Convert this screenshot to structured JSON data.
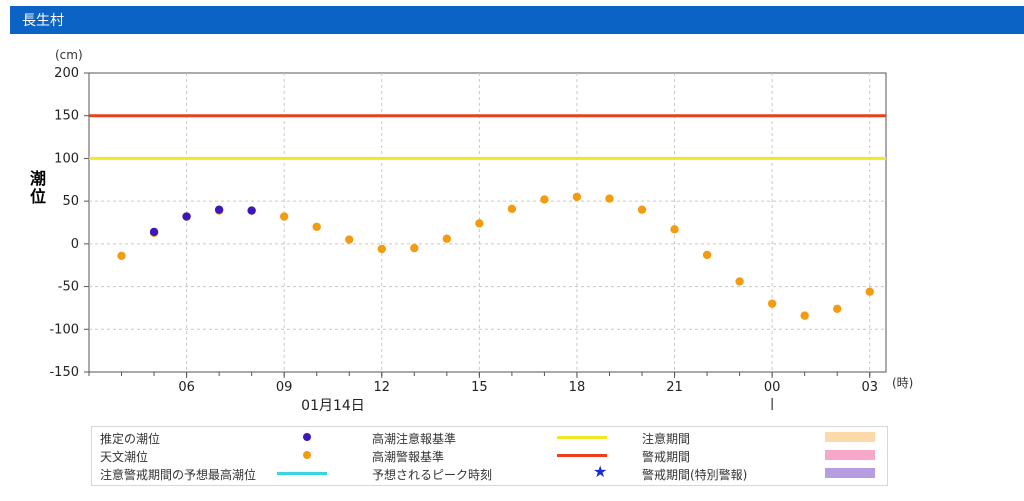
{
  "header": {
    "title": "長生村"
  },
  "chart_data": {
    "type": "scatter",
    "ylabel": "潮位",
    "yunit": "(cm)",
    "xunit": "(時)",
    "date_label": "01月14日",
    "ylim": [
      -150,
      200
    ],
    "yticks": [
      200,
      150,
      100,
      50,
      0,
      -50,
      -100,
      -150
    ],
    "xlim": [
      3,
      27.5
    ],
    "xticks": [
      {
        "x": 6,
        "label": "06"
      },
      {
        "x": 9,
        "label": "09"
      },
      {
        "x": 12,
        "label": "12"
      },
      {
        "x": 15,
        "label": "15"
      },
      {
        "x": 18,
        "label": "18"
      },
      {
        "x": 21,
        "label": "21"
      },
      {
        "x": 24,
        "label": "00"
      },
      {
        "x": 27,
        "label": "03"
      }
    ],
    "grid": true,
    "thresholds": [
      {
        "name": "高潮警報基準",
        "value": 150,
        "color": "#e8421c"
      },
      {
        "name": "高潮注意報基準",
        "value": 100,
        "color": "#eeea24"
      }
    ],
    "series": [
      {
        "name": "天文潮位",
        "color": "#f39c12",
        "points": [
          [
            4,
            -14
          ],
          [
            5,
            13
          ],
          [
            6,
            32
          ],
          [
            7,
            39
          ],
          [
            8,
            39
          ],
          [
            9,
            32
          ],
          [
            10,
            20
          ],
          [
            11,
            5
          ],
          [
            12,
            -6
          ],
          [
            13,
            -5
          ],
          [
            14,
            6
          ],
          [
            15,
            24
          ],
          [
            16,
            41
          ],
          [
            17,
            52
          ],
          [
            18,
            55
          ],
          [
            19,
            53
          ],
          [
            20,
            40
          ],
          [
            21,
            17
          ],
          [
            22,
            -13
          ],
          [
            23,
            -44
          ],
          [
            24,
            -70
          ],
          [
            25,
            -84
          ],
          [
            26,
            -76
          ],
          [
            27,
            -56
          ]
        ]
      },
      {
        "name": "推定の潮位",
        "color": "#3d17b8",
        "points": [
          [
            5,
            14
          ],
          [
            6,
            32
          ],
          [
            7,
            40
          ],
          [
            8,
            39
          ]
        ]
      }
    ]
  },
  "legend": [
    {
      "label": "推定の潮位",
      "symbol": "dot",
      "color": "#3d17b8"
    },
    {
      "label": "高潮注意報基準",
      "symbol": "line",
      "color": "#eeea24"
    },
    {
      "label": "注意期間",
      "symbol": "rect",
      "color": "#fcd9a8"
    },
    {
      "label": "天文潮位",
      "symbol": "dot",
      "color": "#f39c12"
    },
    {
      "label": "高潮警報基準",
      "symbol": "line",
      "color": "#e8421c"
    },
    {
      "label": "警戒期間",
      "symbol": "rect",
      "color": "#f7a8c8"
    },
    {
      "label": "注意警戒期間の予想最高潮位",
      "symbol": "line",
      "color": "#3ad5e0"
    },
    {
      "label": "予想されるピーク時刻",
      "symbol": "star",
      "color": "#1a2bd6"
    },
    {
      "label": "警戒期間(特別警報)",
      "symbol": "rect",
      "color": "#b59ee0"
    }
  ]
}
